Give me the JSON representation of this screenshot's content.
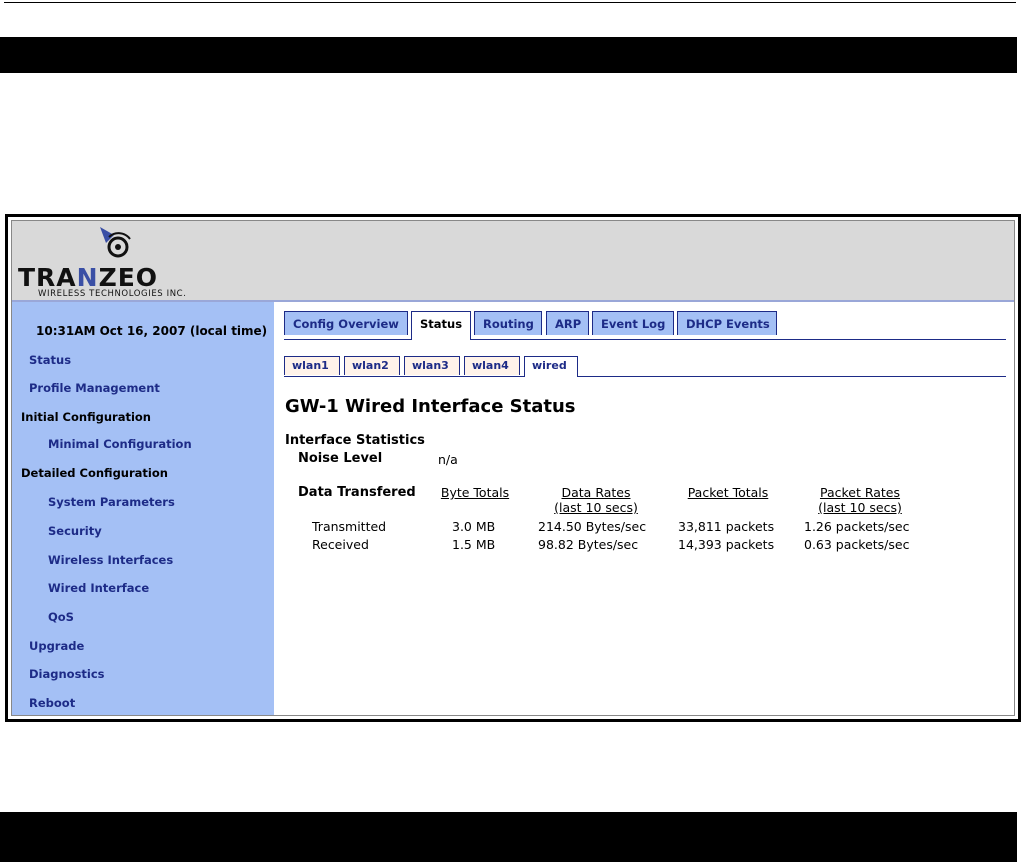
{
  "logo": {
    "name_part1": "TRA",
    "name_accent": "N",
    "name_part2": "ZEO",
    "tagline": "WIRELESS TECHNOLOGIES INC."
  },
  "clock": "10:31AM Oct 16, 2007 (local time)",
  "sidebar": {
    "items": [
      {
        "label": "Status"
      },
      {
        "label": "Profile Management"
      },
      {
        "label": "Initial Configuration"
      },
      {
        "label": "Minimal Configuration"
      },
      {
        "label": "Detailed Configuration"
      },
      {
        "label": "System Parameters"
      },
      {
        "label": "Security"
      },
      {
        "label": "Wireless Interfaces"
      },
      {
        "label": "Wired Interface"
      },
      {
        "label": "QoS"
      },
      {
        "label": "Upgrade"
      },
      {
        "label": "Diagnostics"
      },
      {
        "label": "Reboot"
      }
    ]
  },
  "tabs": [
    {
      "label": "Config Overview"
    },
    {
      "label": "Status",
      "active": true
    },
    {
      "label": "Routing"
    },
    {
      "label": "ARP"
    },
    {
      "label": "Event Log"
    },
    {
      "label": "DHCP Events"
    }
  ],
  "subtabs": [
    {
      "label": "wlan1"
    },
    {
      "label": "wlan2"
    },
    {
      "label": "wlan3"
    },
    {
      "label": "wlan4"
    },
    {
      "label": "wired",
      "active": true
    }
  ],
  "page": {
    "title": "GW-1 Wired Interface Status",
    "interface_statistics": "Interface Statistics",
    "noise_level_label": "Noise Level",
    "noise_level_value": "n/a",
    "data_transfered": "Data Transfered"
  },
  "table": {
    "headers": {
      "byte_totals": "Byte Totals",
      "data_rates_1": "Data Rates",
      "data_rates_2": "(last 10 secs)",
      "packet_totals": "Packet Totals",
      "packet_rates_1": "Packet Rates",
      "packet_rates_2": "(last 10 secs)"
    },
    "rows": [
      {
        "label": "Transmitted",
        "bytes": "3.0 MB",
        "data_rate": "214.50 Bytes/sec",
        "packets": "33,811 packets",
        "packet_rate": "1.26 packets/sec"
      },
      {
        "label": "Received",
        "bytes": "1.5 MB",
        "data_rate": "98.82 Bytes/sec",
        "packets": "14,393 packets",
        "packet_rate": "0.63 packets/sec"
      }
    ]
  },
  "colors": {
    "sidebar_bg": "#a4c0f5",
    "link": "#1d2b87",
    "header_bg": "#d9d9d9"
  }
}
